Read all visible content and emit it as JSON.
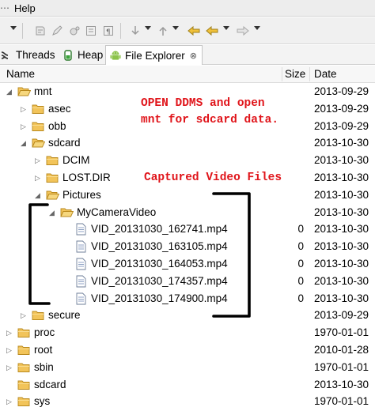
{
  "menubar": {
    "help_label": "Help"
  },
  "tabs": [
    {
      "label": "Threads",
      "icon": "threads-icon",
      "active": false
    },
    {
      "label": "Heap",
      "icon": "heap-icon",
      "active": false
    },
    {
      "label": "File Explorer",
      "icon": "android-icon",
      "active": true,
      "close_glyph": "⊗"
    }
  ],
  "columns": {
    "name": "Name",
    "size": "Size",
    "date": "Date"
  },
  "rows": [
    {
      "name": "mnt",
      "type": "folder",
      "depth": 0,
      "expanded": true,
      "size": "",
      "date": "2013-09-29"
    },
    {
      "name": "asec",
      "type": "folder",
      "depth": 1,
      "expanded": false,
      "size": "",
      "date": "2013-09-29"
    },
    {
      "name": "obb",
      "type": "folder",
      "depth": 1,
      "expanded": false,
      "size": "",
      "date": "2013-09-29"
    },
    {
      "name": "sdcard",
      "type": "folder",
      "depth": 1,
      "expanded": true,
      "size": "",
      "date": "2013-10-30"
    },
    {
      "name": "DCIM",
      "type": "folder",
      "depth": 2,
      "expanded": false,
      "size": "",
      "date": "2013-10-30"
    },
    {
      "name": "LOST.DIR",
      "type": "folder",
      "depth": 2,
      "expanded": false,
      "size": "",
      "date": "2013-10-30"
    },
    {
      "name": "Pictures",
      "type": "folder",
      "depth": 2,
      "expanded": true,
      "size": "",
      "date": "2013-10-30"
    },
    {
      "name": "MyCameraVideo",
      "type": "folder",
      "depth": 3,
      "expanded": true,
      "size": "",
      "date": "2013-10-30"
    },
    {
      "name": "VID_20131030_162741.mp4",
      "type": "file",
      "depth": 4,
      "size": "0",
      "date": "2013-10-30"
    },
    {
      "name": "VID_20131030_163105.mp4",
      "type": "file",
      "depth": 4,
      "size": "0",
      "date": "2013-10-30"
    },
    {
      "name": "VID_20131030_164053.mp4",
      "type": "file",
      "depth": 4,
      "size": "0",
      "date": "2013-10-30"
    },
    {
      "name": "VID_20131030_174357.mp4",
      "type": "file",
      "depth": 4,
      "size": "0",
      "date": "2013-10-30"
    },
    {
      "name": "VID_20131030_174900.mp4",
      "type": "file",
      "depth": 4,
      "size": "0",
      "date": "2013-10-30"
    },
    {
      "name": "secure",
      "type": "folder",
      "depth": 1,
      "expanded": false,
      "size": "",
      "date": "2013-09-29"
    },
    {
      "name": "proc",
      "type": "folder",
      "depth": 0,
      "expanded": false,
      "size": "",
      "date": "1970-01-01"
    },
    {
      "name": "root",
      "type": "folder",
      "depth": 0,
      "expanded": false,
      "size": "",
      "date": "2010-01-28"
    },
    {
      "name": "sbin",
      "type": "folder",
      "depth": 0,
      "expanded": false,
      "size": "",
      "date": "1970-01-01"
    },
    {
      "name": "sdcard",
      "type": "folder",
      "depth": 0,
      "expanded": false,
      "no_twisty": true,
      "size": "",
      "date": "2013-10-30"
    },
    {
      "name": "sys",
      "type": "folder",
      "depth": 0,
      "expanded": false,
      "size": "",
      "date": "1970-01-01"
    }
  ],
  "annotations": {
    "open_ddms_line1": "OPEN DDMS and open",
    "open_ddms_line2": "mnt for sdcard data.",
    "captured_video": "Captured Video Files"
  },
  "colors": {
    "annotation_red": "#e0141a",
    "folder_fill": "#f2c45a",
    "folder_stroke": "#b9891d",
    "bracket": "#000000"
  }
}
